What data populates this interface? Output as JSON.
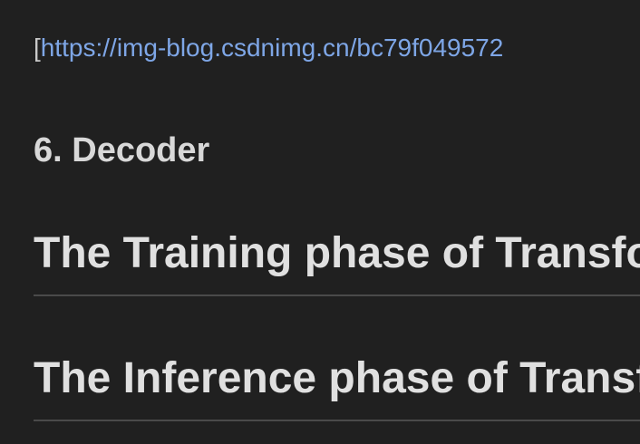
{
  "document": {
    "link_line": {
      "open_bracket": "[",
      "url_text": "https://img-blog.csdnimg.cn/bc79f049572"
    },
    "section_decoder": "6. Decoder",
    "heading_training": "The Training phase of Transformer",
    "heading_inference": "The Inference phase of Transformer"
  },
  "colors": {
    "background": "#202020",
    "text": "#dcdcdc",
    "link": "#7ea6e6",
    "rule": "#4a4a4a"
  }
}
